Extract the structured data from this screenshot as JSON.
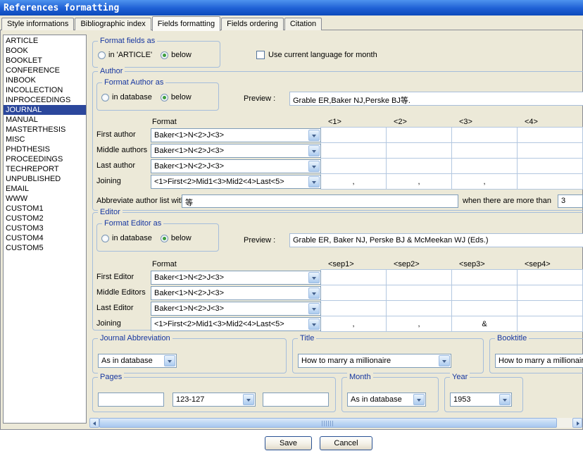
{
  "window": {
    "title": "References formatting"
  },
  "colors": {
    "titlebar": "#1E5FD4",
    "selection": "#2B479C",
    "group_label": "#1636A0"
  },
  "tabs": {
    "items": [
      {
        "label": "Style informations",
        "active": false
      },
      {
        "label": "Bibliographic index",
        "active": false
      },
      {
        "label": "Fields formatting",
        "active": true
      },
      {
        "label": "Fields ordering",
        "active": false
      },
      {
        "label": "Citation",
        "active": false
      }
    ]
  },
  "entry_types": {
    "selected": "JOURNAL",
    "items": [
      "ARTICLE",
      "BOOK",
      "BOOKLET",
      "CONFERENCE",
      "INBOOK",
      "INCOLLECTION",
      "INPROCEEDINGS",
      "JOURNAL",
      "MANUAL",
      "MASTERTHESIS",
      "MISC",
      "PHDTHESIS",
      "PROCEEDINGS",
      "TECHREPORT",
      "UNPUBLISHED",
      "EMAIL",
      "WWW",
      "CUSTOM1",
      "CUSTOM2",
      "CUSTOM3",
      "CUSTOM4",
      "CUSTOM5"
    ]
  },
  "format_fields_as": {
    "legend": "Format fields as",
    "options": [
      {
        "label": "in 'ARTICLE'",
        "selected": false
      },
      {
        "label": "below",
        "selected": true
      }
    ]
  },
  "month_language_checkbox": {
    "label": "Use current language for month",
    "checked": false
  },
  "author": {
    "legend": "Author",
    "format_as": {
      "legend": "Format Author as",
      "options": [
        {
          "label": "in database",
          "selected": false
        },
        {
          "label": "below",
          "selected": true
        }
      ]
    },
    "preview_label": "Preview :",
    "preview_value": "Grable ER,Baker NJ,Perske BJ等.",
    "table": {
      "headers": [
        "Format",
        "<1>",
        "<2>",
        "<3>",
        "<4>"
      ],
      "rows": [
        {
          "label": "First author",
          "format": "Baker<1>N<2>J<3>",
          "cells": [
            "",
            "",
            "",
            ""
          ]
        },
        {
          "label": "Middle authors",
          "format": "Baker<1>N<2>J<3>",
          "cells": [
            "",
            "",
            "",
            ""
          ]
        },
        {
          "label": "Last author",
          "format": "Baker<1>N<2>J<3>",
          "cells": [
            "",
            "",
            "",
            ""
          ]
        },
        {
          "label": "Joining",
          "format": "<1>First<2>Mid1<3>Mid2<4>Last<5>",
          "cells": [
            ",",
            ",",
            ",",
            ""
          ]
        }
      ]
    },
    "abbreviate": {
      "label": "Abbreviate author list with",
      "value": "等",
      "threshold_label": "when there are more than",
      "threshold_value": "3"
    }
  },
  "editor": {
    "legend": "Editor",
    "format_as": {
      "legend": "Format Editor as",
      "options": [
        {
          "label": "in database",
          "selected": false
        },
        {
          "label": "below",
          "selected": true
        }
      ]
    },
    "preview_label": "Preview :",
    "preview_value": "Grable ER, Baker NJ, Perske BJ & McMeekan WJ (Eds.)",
    "table": {
      "headers": [
        "Format",
        "<sep1>",
        "<sep2>",
        "<sep3>",
        "<sep4>"
      ],
      "rows": [
        {
          "label": "First Editor",
          "format": "Baker<1>N<2>J<3>",
          "cells": [
            "",
            "",
            "",
            ""
          ]
        },
        {
          "label": "Middle Editors",
          "format": "Baker<1>N<2>J<3>",
          "cells": [
            "",
            "",
            "",
            ""
          ]
        },
        {
          "label": "Last Editor",
          "format": "Baker<1>N<2>J<3>",
          "cells": [
            "",
            "",
            "",
            ""
          ]
        },
        {
          "label": "Joining",
          "format": "<1>First<2>Mid1<3>Mid2<4>Last<5>",
          "cells": [
            ",",
            ",",
            "&",
            ""
          ]
        }
      ]
    }
  },
  "journal_abbreviation": {
    "legend": "Journal Abbreviation",
    "value": "As in database"
  },
  "title_field": {
    "legend": "Title",
    "value": "How to marry a millionaire"
  },
  "booktitle": {
    "legend": "Booktitle",
    "value": "How to marry a millionaire"
  },
  "pages": {
    "legend": "Pages",
    "first": "",
    "format": "123-127",
    "last": ""
  },
  "month": {
    "legend": "Month",
    "value": "As in database"
  },
  "year": {
    "legend": "Year",
    "value": "1953"
  },
  "buttons": {
    "save": "Save",
    "cancel": "Cancel"
  }
}
